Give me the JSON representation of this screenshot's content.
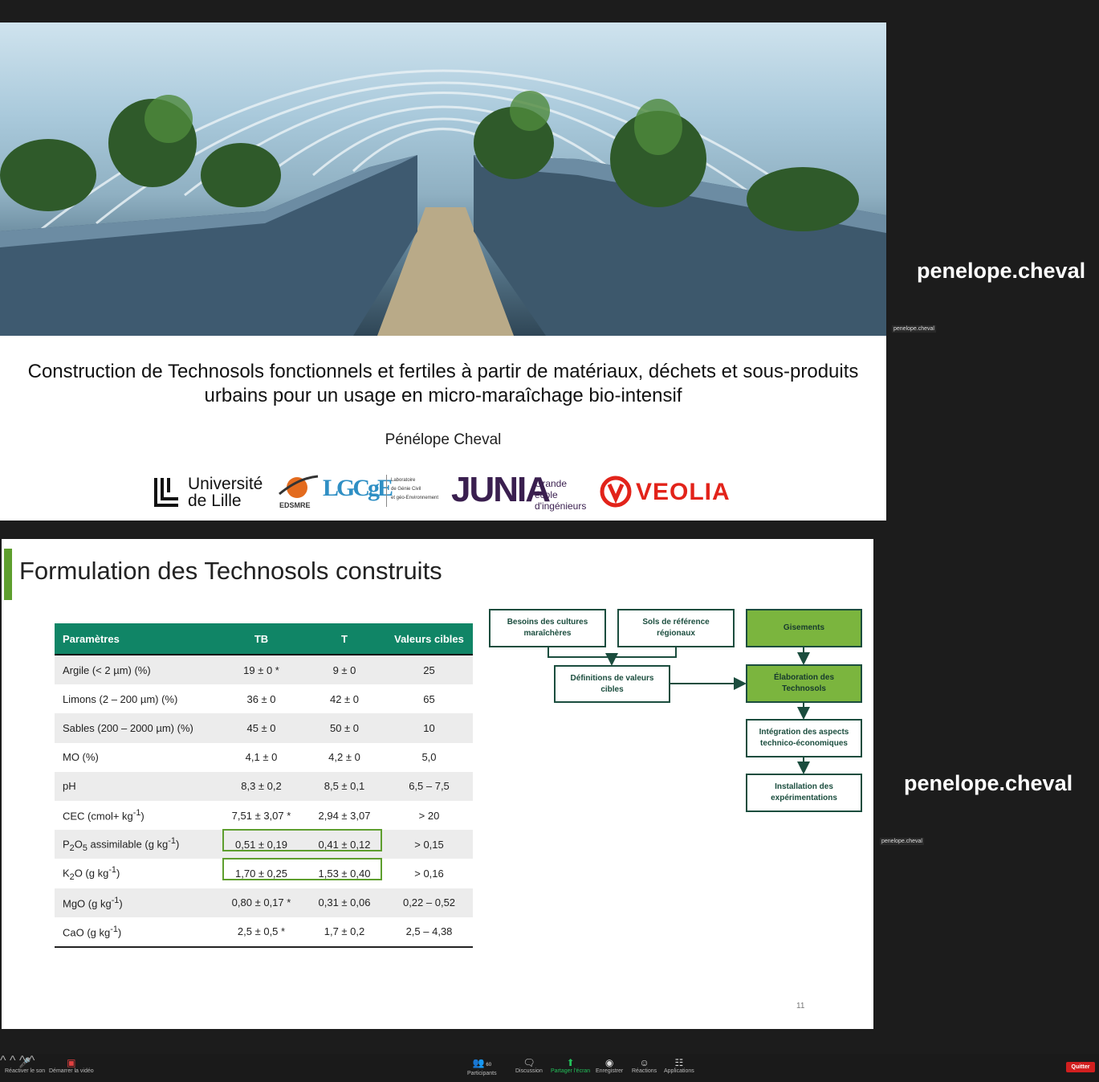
{
  "slide1": {
    "title": "Construction de Technosols fonctionnels et fertiles à partir de matériaux, déchets et sous-produits urbains pour un usage en micro-maraîchage bio-intensif",
    "author": "Pénélope Cheval",
    "logos": {
      "ulille_line1": "Université",
      "ulille_line2": "de Lille",
      "edsmre": "EDSMRE",
      "lgcge_abbr": "LGCgE",
      "lgcge_line1": "Laboratoire",
      "lgcge_line2": "de Génie Civil",
      "lgcge_line3": "et géo-Environnement",
      "junia": "JUNIA",
      "junia_line1": "Grande",
      "junia_line2": "école",
      "junia_line3": "d'ingénieurs",
      "veolia": "VEOLIA"
    }
  },
  "participant_tiles": [
    {
      "name": "penelope.cheval",
      "label": "penelope.cheval"
    },
    {
      "name": "penelope.cheval",
      "label": "penelope.cheval"
    }
  ],
  "slide2": {
    "title": "Formulation des Technosols construits",
    "page_number": "11",
    "table": {
      "headers": [
        "Paramètres",
        "TB",
        "T",
        "Valeurs cibles"
      ],
      "rows": [
        [
          "Argile (< 2 µm) (%)",
          "19 ± 0 *",
          "9 ± 0",
          "25"
        ],
        [
          "Limons (2 – 200 µm) (%)",
          "36 ± 0",
          "42 ± 0",
          "65"
        ],
        [
          "Sables (200 – 2000 µm) (%)",
          "45 ± 0",
          "50 ± 0",
          "10"
        ],
        [
          "MO (%)",
          "4,1 ± 0",
          "4,2 ± 0",
          "5,0"
        ],
        [
          "pH",
          "8,3 ± 0,2",
          "8,5 ± 0,1",
          "6,5 – 7,5"
        ],
        [
          "CEC (cmol+ kg-1)",
          "7,51 ± 3,07 *",
          "2,94 ± 3,07",
          "> 20"
        ],
        [
          "P2O5 assimilable (g kg-1)",
          "0,51 ± 0,19",
          "0,41 ± 0,12",
          "> 0,15"
        ],
        [
          "K2O (g kg-1)",
          "1,70 ± 0,25",
          "1,53 ± 0,40",
          "> 0,16"
        ],
        [
          "MgO (g kg-1)",
          "0,80 ± 0,17 *",
          "0,31 ± 0,06",
          "0,22 – 0,52"
        ],
        [
          "CaO (g kg-1)",
          "2,5 ± 0,5 *",
          "1,7 ± 0,2",
          "2,5 – 4,38"
        ]
      ]
    },
    "flowchart": {
      "besoins": "Besoins des cultures maraîchères",
      "sols": "Sols de référence régionaux",
      "definitions": "Définitions de valeurs cibles",
      "gisements": "Gisements",
      "elaboration": "Élaboration des Technosols",
      "integration": "Intégration des aspects technico-économiques",
      "installation": "Installation des expérimentations"
    }
  },
  "toolbar": {
    "mute": "Réactiver le son",
    "video": "Démarrer la vidéo",
    "participants": "Participants",
    "participants_count": "60",
    "chat": "Discussion",
    "share": "Partager l'écran",
    "record": "Enregistrer",
    "reactions": "Réactions",
    "apps": "Applications",
    "quit": "Quitter"
  },
  "colors": {
    "table_header": "#108566",
    "accent_green": "#5e9e2e",
    "flow_green": "#7bb53e",
    "flow_border": "#1b4d3e",
    "quit_red": "#d21f1f"
  }
}
